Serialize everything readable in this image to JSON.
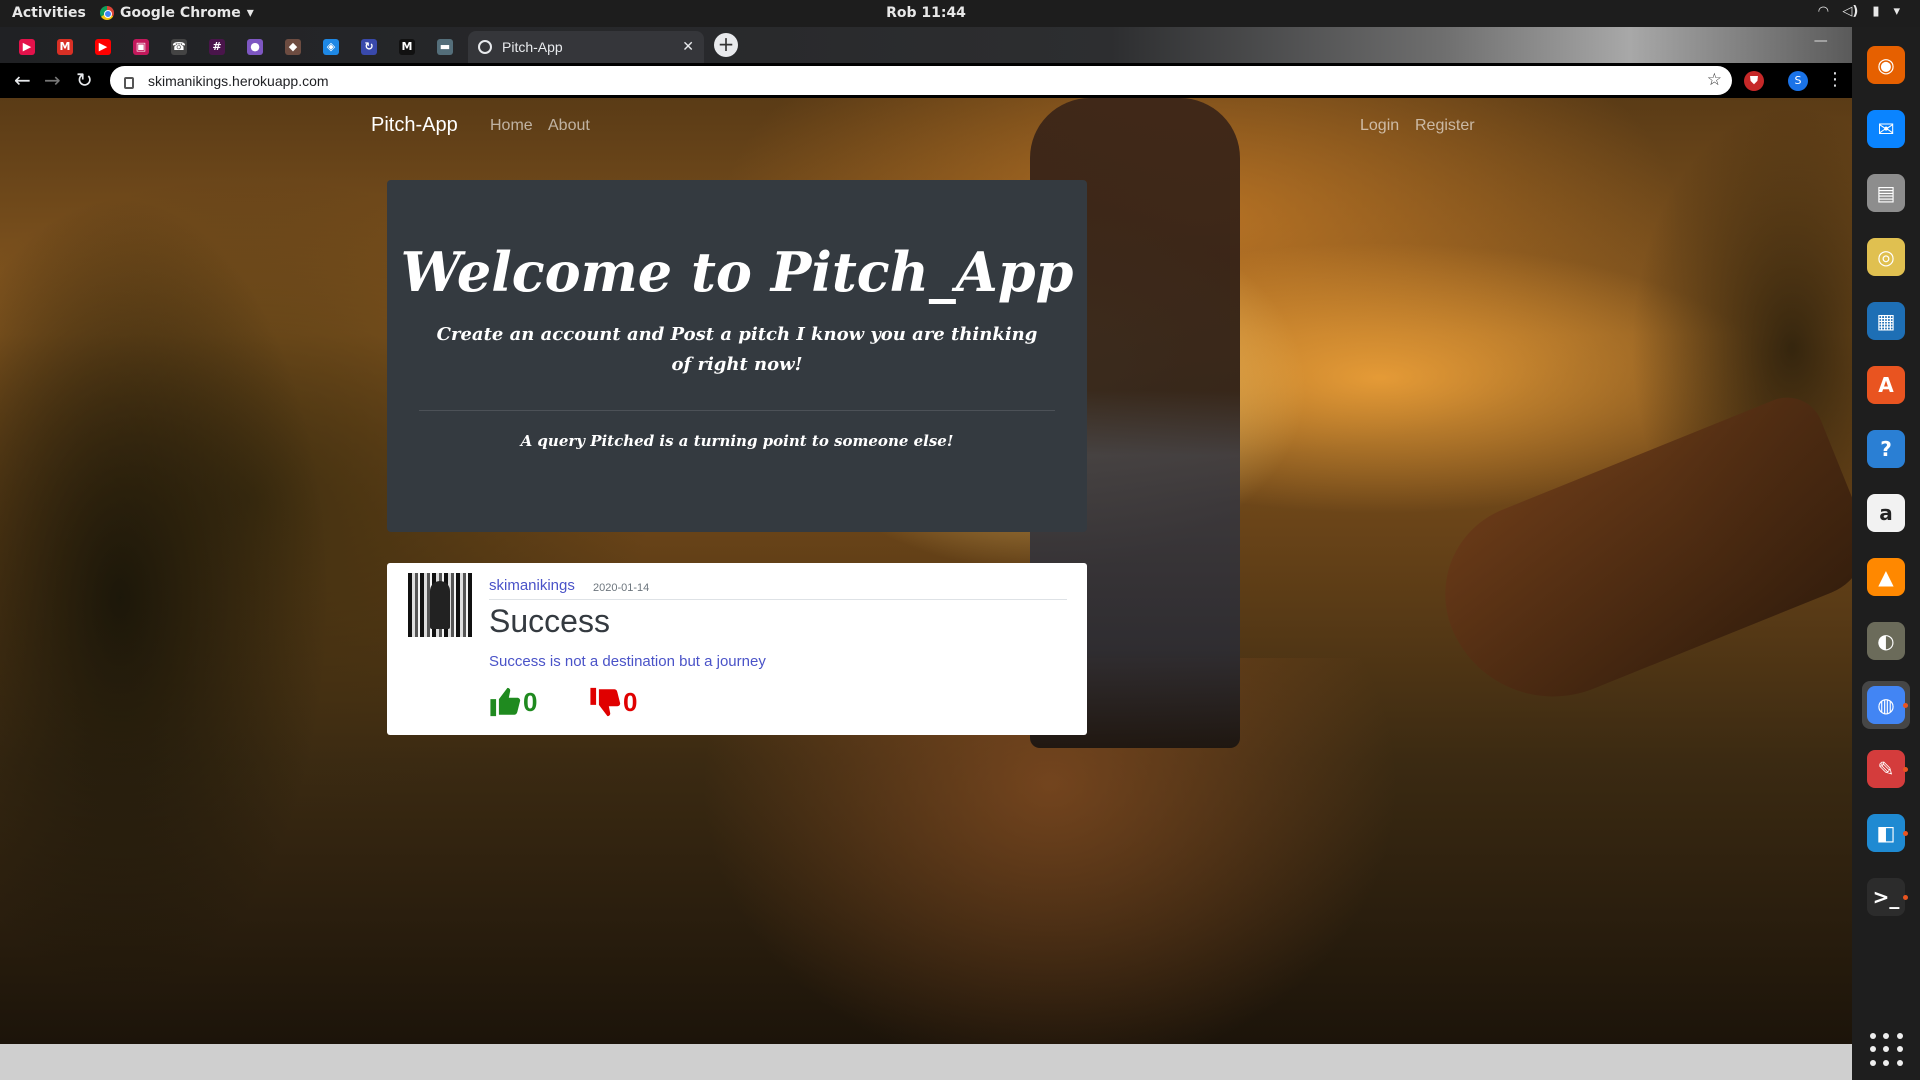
{
  "system_bar": {
    "activities": "Activities",
    "app_name": "Google Chrome",
    "clock": "Rob 11:44"
  },
  "browser": {
    "active_tab_title": "Pitch-App",
    "url": "skimanikings.herokuapp.com",
    "pinned_tabs": [
      {
        "name": "youtube-music-tab",
        "color": "#e3124b",
        "glyph": "▶"
      },
      {
        "name": "gmail-tab",
        "color": "#d93025",
        "glyph": "M"
      },
      {
        "name": "youtube-tab",
        "color": "#ff0000",
        "glyph": "▶"
      },
      {
        "name": "app-tab",
        "color": "#c2185b",
        "glyph": "▣"
      },
      {
        "name": "phone-tab",
        "color": "#444444",
        "glyph": "☎"
      },
      {
        "name": "slack-tab",
        "color": "#4a154b",
        "glyph": "#"
      },
      {
        "name": "extension-tab",
        "color": "#7e57c2",
        "glyph": "●"
      },
      {
        "name": "app-tab-2",
        "color": "#6d4c41",
        "glyph": "◆"
      },
      {
        "name": "shield-tab",
        "color": "#1e88e5",
        "glyph": "◈"
      },
      {
        "name": "sync-tab",
        "color": "#3949ab",
        "glyph": "↻"
      },
      {
        "name": "medium-tab",
        "color": "#111111",
        "glyph": "M"
      },
      {
        "name": "app-tab-3",
        "color": "#546e7a",
        "glyph": "▬"
      }
    ]
  },
  "site": {
    "brand": "Pitch-App",
    "nav_left": [
      "Home",
      "About"
    ],
    "nav_right": [
      "Login",
      "Register"
    ],
    "jumbotron": {
      "heading": "Welcome to Pitch_App",
      "lead": "Create an account and Post a pitch I know you are thinking of right now!",
      "quote": "A query Pitched is a turning point to someone else!"
    },
    "pitch": {
      "author": "skimanikings",
      "date": "2020-01-14",
      "title": "Success",
      "body": "Success is not a destination but a journey",
      "upvotes": "0",
      "downvotes": "0"
    }
  },
  "dock": [
    {
      "name": "firefox-icon",
      "color": "#e66000"
    },
    {
      "name": "thunderbird-icon",
      "color": "#0a84ff"
    },
    {
      "name": "files-icon",
      "color": "#8d8d8d"
    },
    {
      "name": "rhythmbox-icon",
      "color": "#e0c050"
    },
    {
      "name": "libreoffice-writer-icon",
      "color": "#1e6fb5"
    },
    {
      "name": "software-center-icon",
      "color": "#e95420"
    },
    {
      "name": "help-icon",
      "color": "#2a7fd4"
    },
    {
      "name": "amazon-icon",
      "color": "#f2f2f2"
    },
    {
      "name": "vlc-icon",
      "color": "#ff8800"
    },
    {
      "name": "gimp-icon",
      "color": "#6b6b5a"
    },
    {
      "name": "chrome-icon",
      "color": "#4285f4"
    },
    {
      "name": "settings-tool-icon",
      "color": "#d43c3c"
    },
    {
      "name": "vscode-icon",
      "color": "#1f8ad2"
    },
    {
      "name": "terminal-icon",
      "color": "#2c2c2c"
    }
  ]
}
